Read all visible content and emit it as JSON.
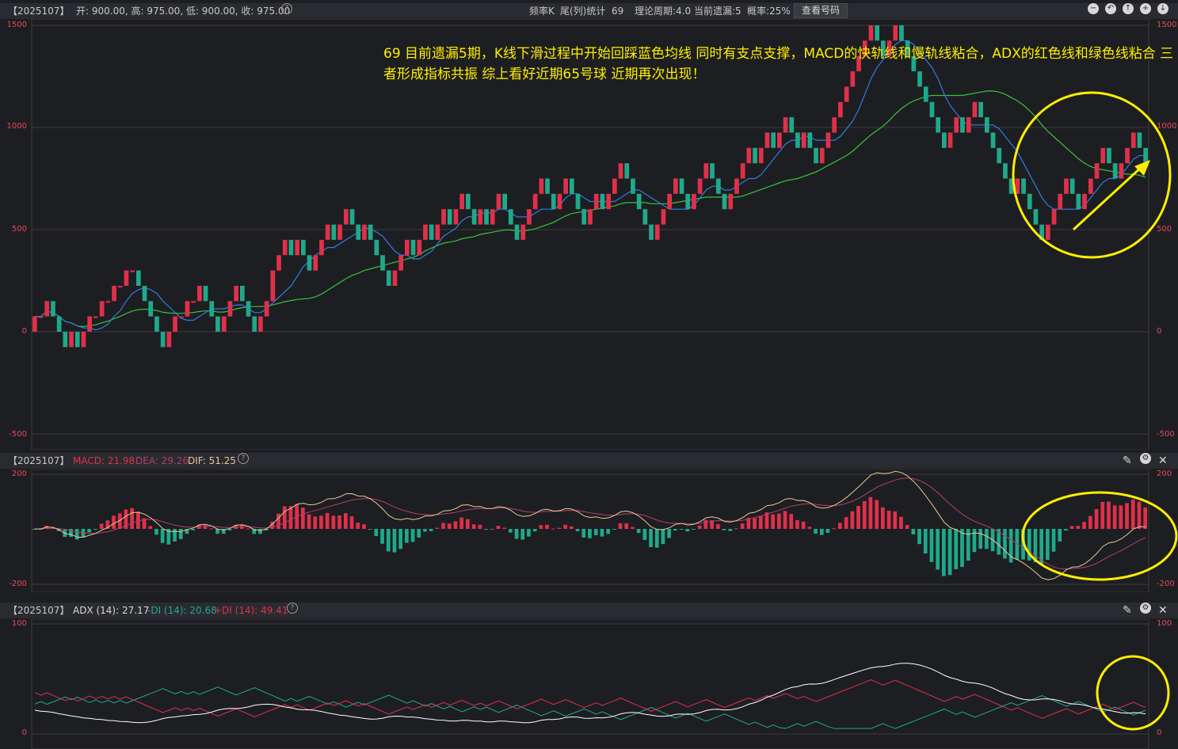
{
  "top_bar": {
    "symbol": "【2025107】",
    "ohlc_text": "开: 900.00, 高: 975.00, 低: 900.00, 收: 975.00",
    "freq_label": "频率K",
    "stat_label": "尾(列)统计",
    "stat_value": "69",
    "theory_cycle": "理论周期:4.0",
    "current_miss": "当前遗漏:5",
    "probability": "概率:25%",
    "view_numbers_button": "查看号码",
    "controls": [
      "minus-circle-icon",
      "back-icon",
      "up-icon",
      "plus-icon",
      "down-icon"
    ]
  },
  "annotation": {
    "text": "69 目前遗漏5期，K线下滑过程中开始回踩蓝色均线 同时有支点支撑，MACD的快轨线和慢轨线粘合，ADX的红色线和绿色线粘合  三者形成指标共振  综上看好近期65号球 近期再次出现！"
  },
  "main_chart": {
    "y_ticks": [
      "1500",
      "1000",
      "500",
      "0",
      "-500"
    ]
  },
  "macd_panel": {
    "symbol": "【2025107】",
    "macd_label": "MACD: 21.98",
    "dea_label": "DEA: 29.26",
    "dif_label": "DIF: 51.25",
    "y_ticks": [
      "200",
      "-200"
    ]
  },
  "adx_panel": {
    "symbol": "【2025107】",
    "adx_label": "ADX (14): 27.17",
    "mdi_label": "-DI (14): 20.68",
    "pdi_label": "+DI (14): 49.41",
    "y_ticks": [
      "100",
      "0"
    ]
  },
  "colors": {
    "background": "#1d1e22",
    "up": "#e0304a",
    "down": "#1fa98a",
    "ma_blue": "#2f7de0",
    "ma_green": "#3ac23a",
    "annotation": "#ffee00",
    "highlight_circle": "#ffee00"
  },
  "chart_data": {
    "type": "candlestick",
    "ylim_main": [
      -500,
      1500
    ],
    "close": [
      75,
      75,
      150,
      75,
      0,
      -75,
      0,
      -75,
      0,
      75,
      75,
      150,
      150,
      225,
      225,
      300,
      300,
      225,
      150,
      75,
      0,
      -75,
      0,
      75,
      75,
      150,
      150,
      225,
      150,
      75,
      0,
      75,
      150,
      225,
      150,
      75,
      0,
      75,
      150,
      300,
      375,
      450,
      375,
      450,
      375,
      300,
      375,
      450,
      525,
      450,
      525,
      600,
      525,
      450,
      525,
      450,
      375,
      300,
      225,
      300,
      375,
      450,
      375,
      450,
      525,
      450,
      525,
      600,
      525,
      600,
      675,
      600,
      525,
      600,
      525,
      600,
      675,
      600,
      525,
      450,
      525,
      600,
      675,
      750,
      675,
      600,
      675,
      750,
      675,
      600,
      525,
      600,
      675,
      600,
      675,
      750,
      825,
      750,
      675,
      600,
      525,
      450,
      525,
      600,
      675,
      750,
      675,
      600,
      675,
      750,
      825,
      750,
      675,
      600,
      675,
      750,
      825,
      900,
      825,
      900,
      975,
      900,
      975,
      1050,
      975,
      900,
      975,
      900,
      825,
      900,
      975,
      1050,
      1125,
      1200,
      1275,
      1350,
      1425,
      1500,
      1425,
      1350,
      1425,
      1500,
      1425,
      1350,
      1275,
      1200,
      1125,
      1050,
      975,
      900,
      975,
      1050,
      975,
      1050,
      1125,
      1050,
      975,
      900,
      825,
      750,
      675,
      750,
      675,
      600,
      525,
      450,
      525,
      600,
      675,
      750,
      675,
      600,
      675,
      750,
      825,
      900,
      825,
      750,
      825,
      900,
      975,
      900,
      825
    ]
  }
}
